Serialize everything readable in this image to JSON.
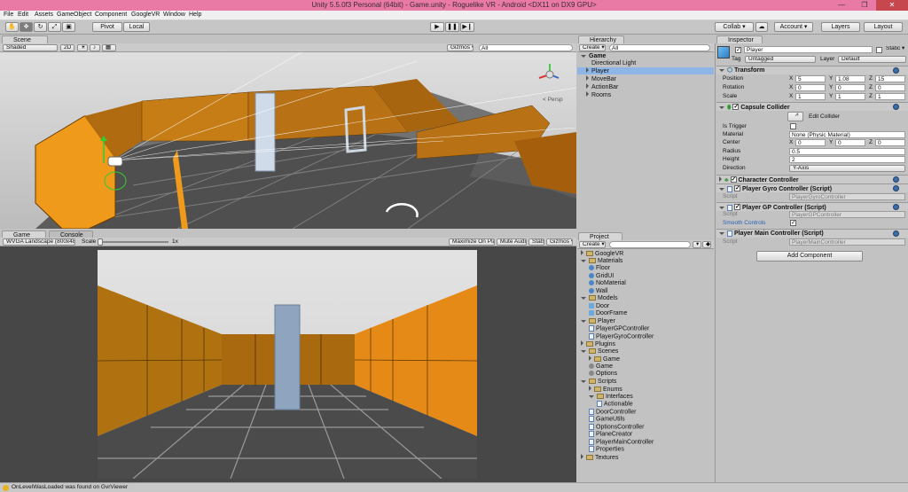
{
  "title_bar": {
    "title": "Unity 5.5.0f3 Personal (64bit) - Game.unity - Roguelike VR - Android <DX11 on DX9 GPU>",
    "min": "—",
    "max": "❐",
    "close": "✕"
  },
  "menu": [
    "File",
    "Edit",
    "Assets",
    "GameObject",
    "Component",
    "GoogleVR",
    "Window",
    "Help"
  ],
  "toolbar": {
    "pivot": "Pivot",
    "local": "Local",
    "collab": "Collab ▾",
    "account": "Account ▾",
    "layers": "Layers",
    "layout": "Layout"
  },
  "scene": {
    "tab": "Scene",
    "shaded": "Shaded",
    "mode_2d": "2D",
    "gizmos": "Gizmos ▾",
    "search": "All",
    "persp": "< Persp"
  },
  "game": {
    "tab": "Game",
    "console_tab": "Console",
    "resolution": "WVGA Landscape (800x480)",
    "scale_label": "Scale",
    "scale_value": "1x",
    "maximize": "Maximize On Play",
    "mute": "Mute Audio",
    "stats": "Stats",
    "gizmos": "Gizmos ▾"
  },
  "hierarchy": {
    "tab": "Hierarchy",
    "create": "Create ▾",
    "search": "All",
    "scene": "Game",
    "items": [
      "Directional Light",
      "Player",
      "MoveBar",
      "ActionBar",
      "Rooms"
    ]
  },
  "project": {
    "tab": "Project",
    "create": "Create ▾",
    "tree": [
      {
        "label": "GoogleVR",
        "kind": "folder",
        "indent": 0
      },
      {
        "label": "Materials",
        "kind": "folder",
        "indent": 0
      },
      {
        "label": "Floor",
        "kind": "material",
        "indent": 1
      },
      {
        "label": "GridUI",
        "kind": "material",
        "indent": 1
      },
      {
        "label": "NoMaterial",
        "kind": "material",
        "indent": 1
      },
      {
        "label": "Wall",
        "kind": "material",
        "indent": 1
      },
      {
        "label": "Models",
        "kind": "folder",
        "indent": 0
      },
      {
        "label": "Door",
        "kind": "model",
        "indent": 1
      },
      {
        "label": "DoorFrame",
        "kind": "model",
        "indent": 1
      },
      {
        "label": "Player",
        "kind": "folder",
        "indent": 0
      },
      {
        "label": "PlayerGPController",
        "kind": "script",
        "indent": 1
      },
      {
        "label": "PlayerGyroController",
        "kind": "script",
        "indent": 1
      },
      {
        "label": "Plugins",
        "kind": "folder",
        "indent": 0
      },
      {
        "label": "Scenes",
        "kind": "folder",
        "indent": 0
      },
      {
        "label": "Game",
        "kind": "folder",
        "indent": 1
      },
      {
        "label": "Game",
        "kind": "scene",
        "indent": 1
      },
      {
        "label": "Options",
        "kind": "scene",
        "indent": 1
      },
      {
        "label": "Scripts",
        "kind": "folder",
        "indent": 0
      },
      {
        "label": "Enums",
        "kind": "folder",
        "indent": 1
      },
      {
        "label": "Interfaces",
        "kind": "folder",
        "indent": 1
      },
      {
        "label": "Actionable",
        "kind": "script",
        "indent": 2
      },
      {
        "label": "DoorController",
        "kind": "script",
        "indent": 1
      },
      {
        "label": "GameUtils",
        "kind": "script",
        "indent": 1
      },
      {
        "label": "OptionsController",
        "kind": "script",
        "indent": 1
      },
      {
        "label": "PlaneCreator",
        "kind": "script",
        "indent": 1
      },
      {
        "label": "PlayerMainController",
        "kind": "script",
        "indent": 1
      },
      {
        "label": "Properties",
        "kind": "script",
        "indent": 1
      },
      {
        "label": "Textures",
        "kind": "folder",
        "indent": 0
      }
    ]
  },
  "inspector": {
    "tab": "Inspector",
    "object_name": "Player",
    "static": "Static ▾",
    "tag_label": "Tag",
    "tag": "Untagged",
    "layer_label": "Layer",
    "layer": "Default",
    "transform": {
      "title": "Transform",
      "position": {
        "label": "Position",
        "x": "5",
        "y": "1.08",
        "z": "15"
      },
      "rotation": {
        "label": "Rotation",
        "x": "0",
        "y": "0",
        "z": "0"
      },
      "scale": {
        "label": "Scale",
        "x": "1",
        "y": "1",
        "z": "1"
      }
    },
    "collider": {
      "title": "Capsule Collider",
      "edit": "Edit Collider",
      "is_trigger": "Is Trigger",
      "material_label": "Material",
      "material": "None (Physic Material)",
      "center_label": "Center",
      "cx": "0",
      "cy": "0",
      "cz": "0",
      "radius_label": "Radius",
      "radius": "0.5",
      "height_label": "Height",
      "height": "2",
      "direction_label": "Direction",
      "direction": "Y-Axis"
    },
    "char_ctrl": "Character Controller",
    "gyro": {
      "title": "Player Gyro Controller (Script)",
      "script_label": "Script",
      "script": "PlayerGyroController"
    },
    "gp": {
      "title": "Player GP Controller (Script)",
      "script_label": "Script",
      "script": "PlayerGPController",
      "smooth": "Smooth Controls"
    },
    "main": {
      "title": "Player Main Controller (Script)",
      "script_label": "Script",
      "script": "PlayerMainController"
    },
    "add_component": "Add Component"
  },
  "status": {
    "message": "OnLevelWasLoaded was found on GvrViewer"
  },
  "colors": {
    "title": "#e87aa5",
    "wall": "#c97a12",
    "accent": "#3e7bd6"
  }
}
